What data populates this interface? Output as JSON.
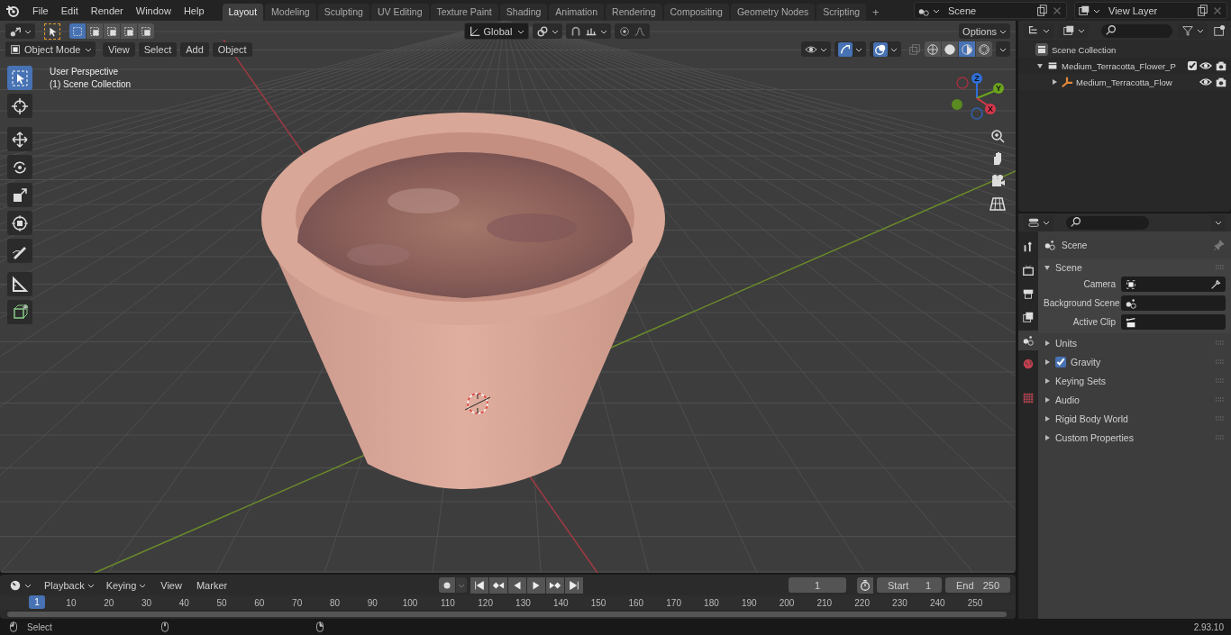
{
  "menu": [
    "File",
    "Edit",
    "Render",
    "Window",
    "Help"
  ],
  "workspaces": [
    {
      "label": "Layout",
      "selected": true
    },
    {
      "label": "Modeling",
      "selected": false
    },
    {
      "label": "Sculpting",
      "selected": false
    },
    {
      "label": "UV Editing",
      "selected": false
    },
    {
      "label": "Texture Paint",
      "selected": false
    },
    {
      "label": "Shading",
      "selected": false
    },
    {
      "label": "Animation",
      "selected": false
    },
    {
      "label": "Rendering",
      "selected": false
    },
    {
      "label": "Compositing",
      "selected": false
    },
    {
      "label": "Geometry Nodes",
      "selected": false
    },
    {
      "label": "Scripting",
      "selected": false
    }
  ],
  "add_workspace": "+",
  "scene_field": {
    "value": "Scene"
  },
  "view_layer_field": {
    "value": "View Layer"
  },
  "viewport": {
    "select_modes": [
      {
        "selected": true
      },
      {
        "selected": false
      },
      {
        "selected": false
      },
      {
        "selected": false
      },
      {
        "selected": false
      }
    ],
    "transform_orientation": "Global",
    "options": "Options",
    "mode": "Object Mode",
    "menus": [
      "View",
      "Select",
      "Add",
      "Object"
    ],
    "toggles": [
      {
        "kind": "gizmo",
        "on": true
      },
      {
        "kind": "overlay",
        "on": true
      }
    ],
    "shading_modes": [
      {
        "selected": false
      },
      {
        "selected": false
      },
      {
        "selected": true
      },
      {
        "selected": false
      }
    ],
    "overlay_text": [
      "User Perspective",
      "(1) Scene Collection"
    ],
    "tools": [
      {
        "kind": "select",
        "selected": true
      },
      {
        "kind": "cursor",
        "selected": false
      },
      {
        "kind": "move",
        "selected": false
      },
      {
        "kind": "rotate",
        "selected": false
      },
      {
        "kind": "scale",
        "selected": false
      },
      {
        "kind": "transform",
        "selected": false
      },
      {
        "kind": "annotate",
        "selected": false
      },
      {
        "kind": "measure",
        "selected": false
      },
      {
        "kind": "add_cube",
        "selected": false
      }
    ],
    "gizmo_axes": [
      {
        "label": "Z",
        "color": "#2f6fd8"
      },
      {
        "label": "Y",
        "color": "#6ba41e"
      },
      {
        "label": "X",
        "color": "#d5364a"
      }
    ]
  },
  "outliner": {
    "root": "Scene Collection",
    "items": [
      {
        "label": "Medium_Terracotta_Flower_P",
        "expanded": true,
        "checked": true,
        "children": [
          {
            "label": "Medium_Terracotta_Flow",
            "expanded": false
          }
        ]
      }
    ]
  },
  "properties": {
    "tabs": [
      {
        "kind": "tool",
        "selected": false
      },
      {
        "kind": "render",
        "selected": false
      },
      {
        "kind": "output",
        "selected": false
      },
      {
        "kind": "view_layer",
        "selected": false
      },
      {
        "kind": "scene",
        "selected": true
      },
      {
        "kind": "world",
        "selected": false
      },
      {
        "kind": "texture",
        "selected": false
      }
    ],
    "context": "Scene",
    "panel": {
      "label": "Scene",
      "expanded": true,
      "fields": [
        {
          "label": "Camera",
          "kind": "camera"
        },
        {
          "label": "Background Scene",
          "kind": "scene"
        },
        {
          "label": "Active Clip",
          "kind": "clip"
        }
      ]
    },
    "sections": [
      {
        "label": "Units",
        "expanded": false
      },
      {
        "label": "Gravity",
        "expanded": false,
        "checked": true
      },
      {
        "label": "Keying Sets",
        "expanded": false
      },
      {
        "label": "Audio",
        "expanded": false
      },
      {
        "label": "Rigid Body World",
        "expanded": false
      },
      {
        "label": "Custom Properties",
        "expanded": false
      }
    ]
  },
  "timeline": {
    "menus": [
      "Playback",
      "Keying"
    ],
    "plain_menus": [
      "View",
      "Marker"
    ],
    "current_frame": "1",
    "start_label": "Start",
    "start": "1",
    "end_label": "End",
    "end": "250",
    "playhead": "1",
    "ticks": [
      "10",
      "20",
      "30",
      "40",
      "50",
      "60",
      "70",
      "80",
      "90",
      "100",
      "110",
      "120",
      "130",
      "140",
      "150",
      "160",
      "170",
      "180",
      "190",
      "200",
      "210",
      "220",
      "230",
      "240",
      "250"
    ]
  },
  "status_bar": {
    "action": "Select",
    "version": "2.93.10"
  }
}
